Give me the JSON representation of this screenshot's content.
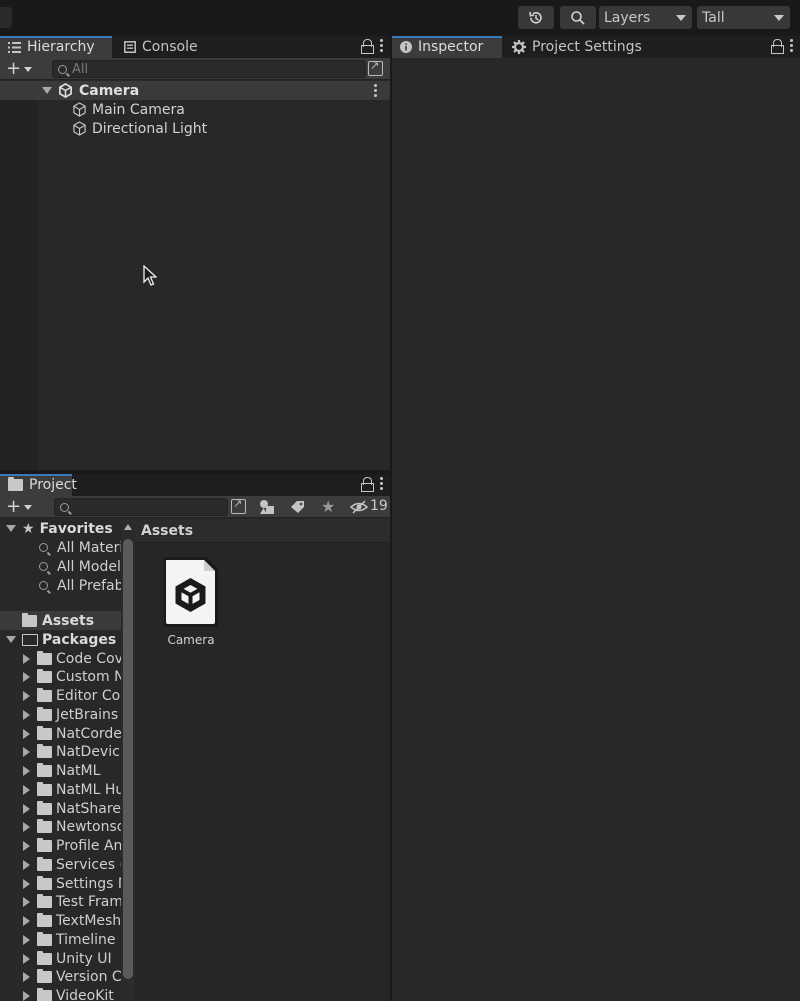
{
  "toolbar": {
    "layers_label": "Layers",
    "layout_label": "Tall"
  },
  "hierarchy": {
    "tab_label": "Hierarchy",
    "console_tab_label": "Console",
    "search_placeholder": "All",
    "scene_name": "Camera",
    "items": [
      {
        "label": "Main Camera"
      },
      {
        "label": "Directional Light"
      }
    ]
  },
  "inspector": {
    "tab_label": "Inspector",
    "project_settings_tab_label": "Project Settings"
  },
  "project": {
    "tab_label": "Project",
    "hidden_count": "19",
    "favorites": {
      "label": "Favorites",
      "items": [
        {
          "label": "All Materi"
        },
        {
          "label": "All Model"
        },
        {
          "label": "All Prefab"
        }
      ]
    },
    "assets_label": "Assets",
    "packages_label": "Packages",
    "packages": [
      {
        "label": "Code Cov"
      },
      {
        "label": "Custom N"
      },
      {
        "label": "Editor Cor"
      },
      {
        "label": "JetBrains"
      },
      {
        "label": "NatCorde"
      },
      {
        "label": "NatDevic"
      },
      {
        "label": "NatML"
      },
      {
        "label": "NatML Hu"
      },
      {
        "label": "NatShare"
      },
      {
        "label": "Newtonso"
      },
      {
        "label": "Profile An"
      },
      {
        "label": "Services ("
      },
      {
        "label": "Settings M"
      },
      {
        "label": "Test Fram"
      },
      {
        "label": "TextMesh"
      },
      {
        "label": "Timeline"
      },
      {
        "label": "Unity UI"
      },
      {
        "label": "Version C"
      },
      {
        "label": "VideoKit"
      }
    ],
    "breadcrumb": "Assets",
    "asset_tiles": [
      {
        "label": "Camera",
        "icon": "unity-scene-icon"
      }
    ]
  },
  "colors": {
    "accent": "#3a79bb",
    "panel_bg": "#282828",
    "tab_active_bg": "#3c3c3c"
  }
}
